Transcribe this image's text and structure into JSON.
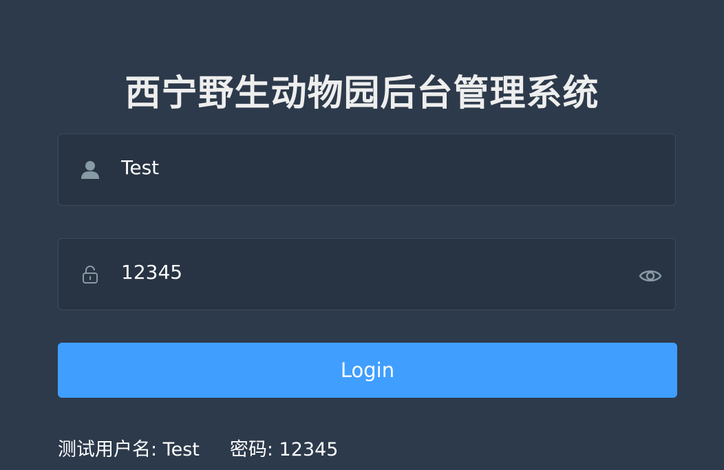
{
  "page": {
    "title": "西宁野生动物园后台管理系统"
  },
  "form": {
    "username": {
      "value": "Test",
      "icon": "user-icon"
    },
    "password": {
      "value": "12345",
      "icon": "lock-icon",
      "toggle_icon": "eye-icon"
    },
    "login_label": "Login"
  },
  "tips": {
    "user_label": "测试用户名: Test",
    "pass_label": "密码: 12345"
  },
  "colors": {
    "background": "#2d3a4b",
    "input_background": "#283443",
    "accent": "#409eff",
    "icon": "#889aa4"
  }
}
